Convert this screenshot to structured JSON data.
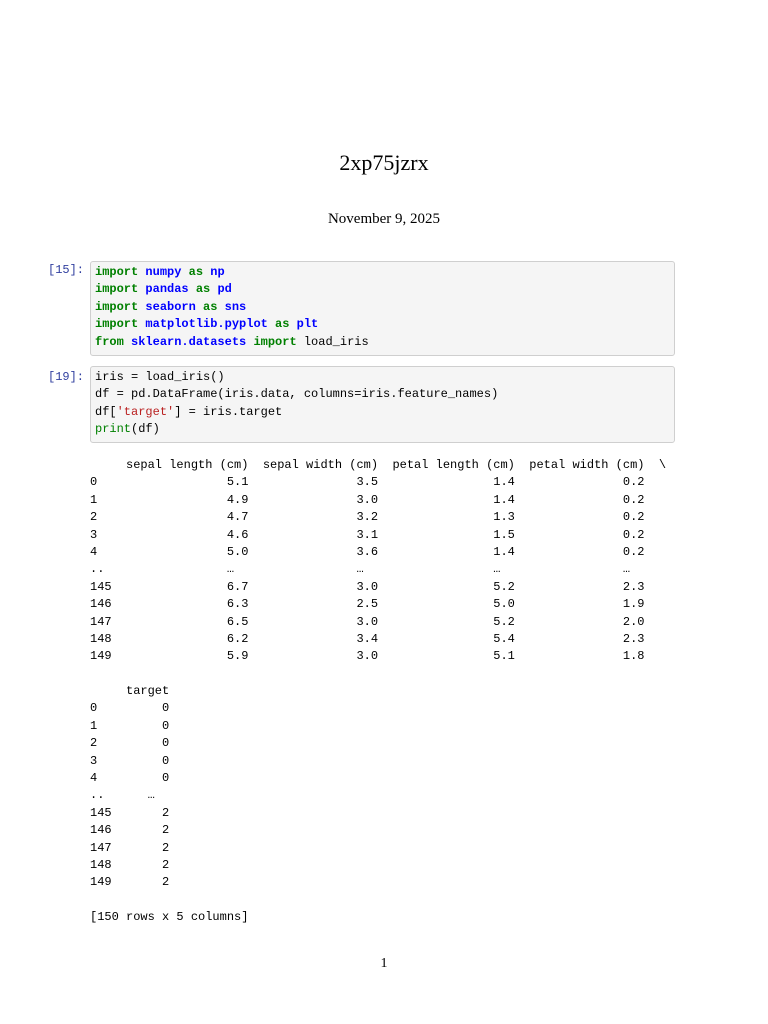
{
  "title": "2xp75jzrx",
  "date": "November 9, 2025",
  "cells": [
    {
      "prompt": "[15]:",
      "lines": [
        [
          {
            "t": "import",
            "c": "k"
          },
          {
            "t": " ",
            "c": "p"
          },
          {
            "t": "numpy",
            "c": "n"
          },
          {
            "t": " ",
            "c": "p"
          },
          {
            "t": "as",
            "c": "k"
          },
          {
            "t": " ",
            "c": "p"
          },
          {
            "t": "np",
            "c": "n"
          }
        ],
        [
          {
            "t": "import",
            "c": "k"
          },
          {
            "t": " ",
            "c": "p"
          },
          {
            "t": "pandas",
            "c": "n"
          },
          {
            "t": " ",
            "c": "p"
          },
          {
            "t": "as",
            "c": "k"
          },
          {
            "t": " ",
            "c": "p"
          },
          {
            "t": "pd",
            "c": "n"
          }
        ],
        [
          {
            "t": "import",
            "c": "k"
          },
          {
            "t": " ",
            "c": "p"
          },
          {
            "t": "seaborn",
            "c": "n"
          },
          {
            "t": " ",
            "c": "p"
          },
          {
            "t": "as",
            "c": "k"
          },
          {
            "t": " ",
            "c": "p"
          },
          {
            "t": "sns",
            "c": "n"
          }
        ],
        [
          {
            "t": "import",
            "c": "k"
          },
          {
            "t": " ",
            "c": "p"
          },
          {
            "t": "matplotlib.pyplot",
            "c": "n"
          },
          {
            "t": " ",
            "c": "p"
          },
          {
            "t": "as",
            "c": "k"
          },
          {
            "t": " ",
            "c": "p"
          },
          {
            "t": "plt",
            "c": "n"
          }
        ],
        [
          {
            "t": "from",
            "c": "k"
          },
          {
            "t": " ",
            "c": "p"
          },
          {
            "t": "sklearn.datasets",
            "c": "n"
          },
          {
            "t": " ",
            "c": "p"
          },
          {
            "t": "import",
            "c": "k"
          },
          {
            "t": " load_iris",
            "c": "p"
          }
        ]
      ]
    },
    {
      "prompt": "[19]:",
      "lines": [
        [
          {
            "t": "iris = load_iris()",
            "c": "p"
          }
        ],
        [
          {
            "t": "df = pd.DataFrame(iris.data, columns=iris.feature_names)",
            "c": "p"
          }
        ],
        [
          {
            "t": "df[",
            "c": "p"
          },
          {
            "t": "'target'",
            "c": "s"
          },
          {
            "t": "] = iris.target",
            "c": "p"
          }
        ],
        [
          {
            "t": "print",
            "c": "b"
          },
          {
            "t": "(df)",
            "c": "p"
          }
        ]
      ]
    }
  ],
  "output": [
    "     sepal length (cm)  sepal width (cm)  petal length (cm)  petal width (cm)  \\",
    "0                  5.1               3.5                1.4               0.2",
    "1                  4.9               3.0                1.4               0.2",
    "2                  4.7               3.2                1.3               0.2",
    "3                  4.6               3.1                1.5               0.2",
    "4                  5.0               3.6                1.4               0.2",
    "..                 …                 …                  …                 …",
    "145                6.7               3.0                5.2               2.3",
    "146                6.3               2.5                5.0               1.9",
    "147                6.5               3.0                5.2               2.0",
    "148                6.2               3.4                5.4               2.3",
    "149                5.9               3.0                5.1               1.8",
    "",
    "     target",
    "0         0",
    "1         0",
    "2         0",
    "3         0",
    "4         0",
    "..      …",
    "145       2",
    "146       2",
    "147       2",
    "148       2",
    "149       2",
    "",
    "[150 rows x 5 columns]"
  ],
  "page_number": "1"
}
